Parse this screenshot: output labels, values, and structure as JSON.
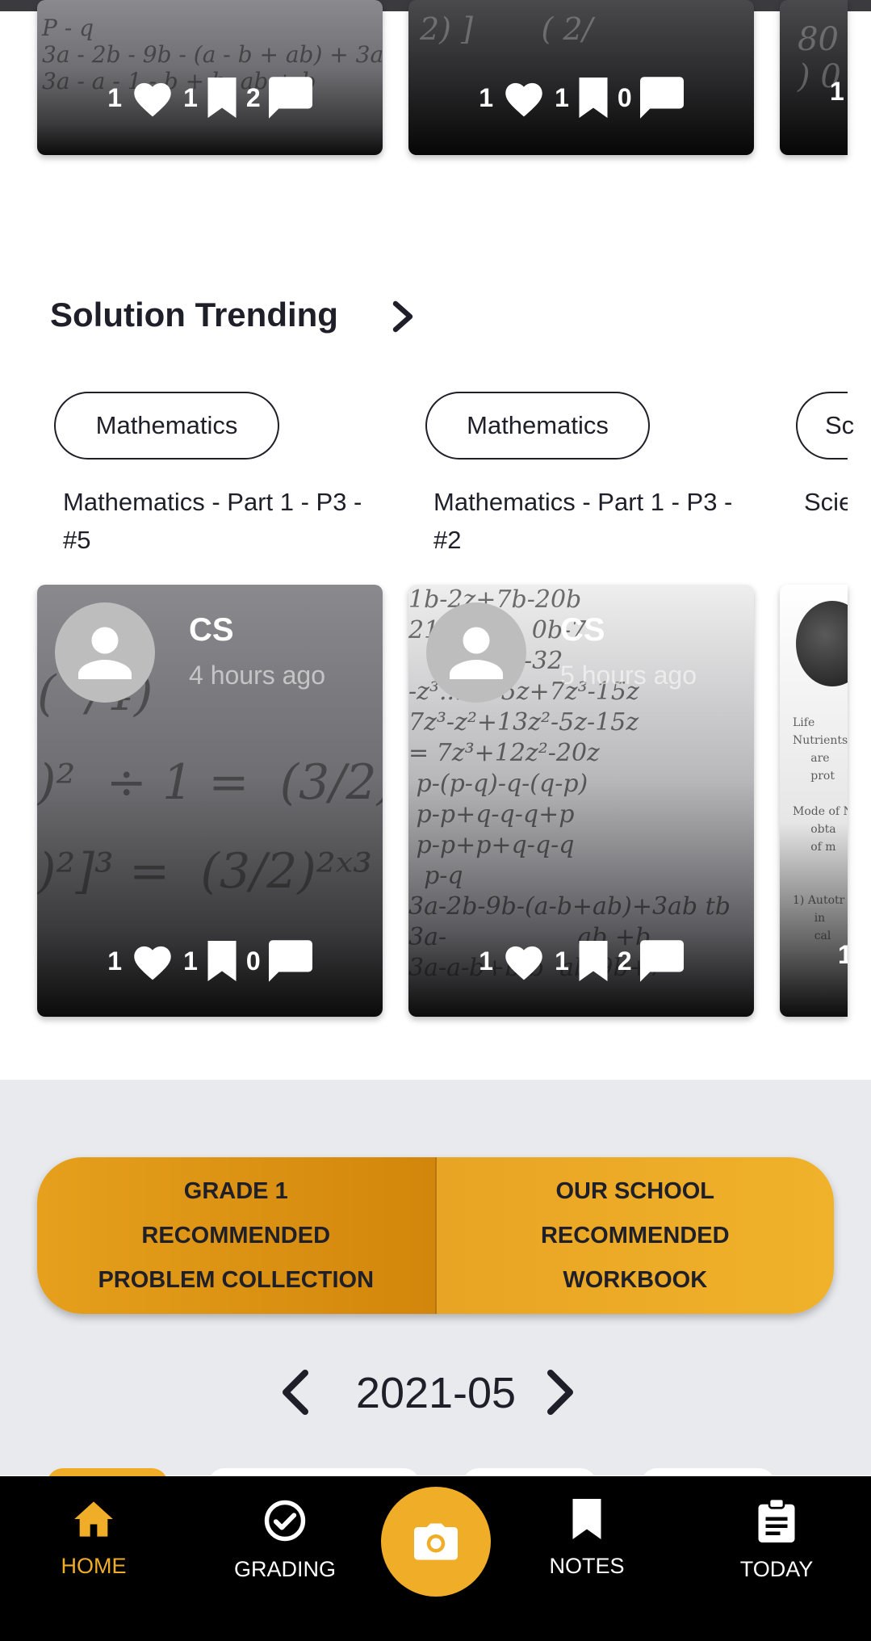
{
  "top_row": {
    "cards": [
      {
        "likes": "1",
        "saves": "1",
        "comments": "2"
      },
      {
        "likes": "1",
        "saves": "1",
        "comments": "0"
      },
      {
        "likes": "1"
      }
    ]
  },
  "solution_trending": {
    "title": "Solution Trending",
    "items": [
      {
        "tag": "Mathematics",
        "title": "Mathematics - Part 1 - P3 - #5",
        "author": "CS",
        "time": "4 hours ago",
        "likes": "1",
        "saves": "1",
        "comments": "0"
      },
      {
        "tag": "Mathematics",
        "title": "Mathematics - Part 1 - P3 - #2",
        "author": "CS",
        "time": "5 hours ago",
        "likes": "1",
        "saves": "1",
        "comments": "2"
      },
      {
        "tag": "Sc",
        "title": "Scie",
        "likes": "1"
      }
    ]
  },
  "recommended": {
    "left": "GRADE 1\nRECOMMENDED\nPROBLEM COLLECTION",
    "right": "OUR SCHOOL\nRECOMMENDED\nWORKBOOK"
  },
  "month": {
    "label": "2021-05"
  },
  "bottom_nav": {
    "items": [
      {
        "label": "HOME",
        "icon": "home-icon",
        "active": true
      },
      {
        "label": "GRADING",
        "icon": "check-circle-icon"
      },
      {
        "label": "NOTES",
        "icon": "bookmark-icon"
      },
      {
        "label": "TODAY",
        "icon": "clipboard-icon"
      }
    ],
    "camera_icon": "camera-icon"
  },
  "colors": {
    "accent": "#f0ad28",
    "text": "#1f1f29",
    "band": "#e9eaee"
  }
}
